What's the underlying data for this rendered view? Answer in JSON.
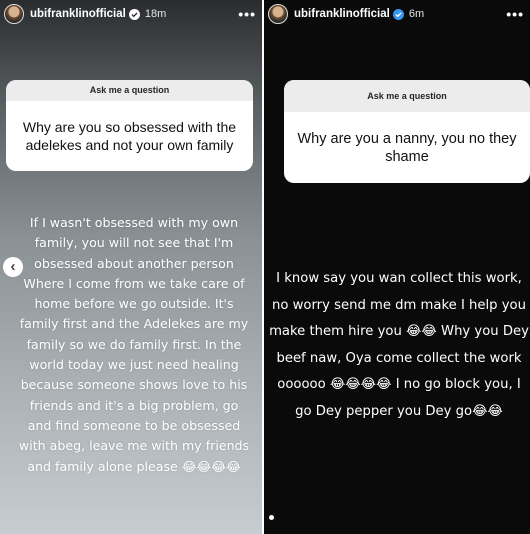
{
  "left_story": {
    "username": "ubifranklinofficial",
    "time": "18m",
    "more": "•••",
    "question_header": "Ask me a question",
    "question": "Why are you so obsessed with the adelekes and not your own family",
    "answer": "If I wasn't obsessed with my own family, you will not see that I'm obsessed about another person Where I come from we take care of home before we go outside. It's family first and the Adelekes are my family so we do family first. In the world today we just need healing because someone shows love to his friends and it's a big problem, go and find someone to be obsessed with abeg, leave me with my friends and family alone please 😂😂😂😂",
    "prev_icon": "‹"
  },
  "right_story": {
    "username": "ubifranklinofficial",
    "time": "6m",
    "more": "•••",
    "question_header": "Ask me a question",
    "question": "Why are you a nanny, you no they shame",
    "answer": "I know say you wan collect this work, no worry send me dm make I help you make them hire you 😂😂 Why you Dey beef naw, Oya come collect the work oooooo 😂😂😂😂 I no go block you, I go Dey pepper you Dey go😂😂"
  },
  "colors": {
    "verified_badge": "#3897f0",
    "question_header_bg": "#ececec",
    "right_story_bg": "#0a0a0a"
  }
}
